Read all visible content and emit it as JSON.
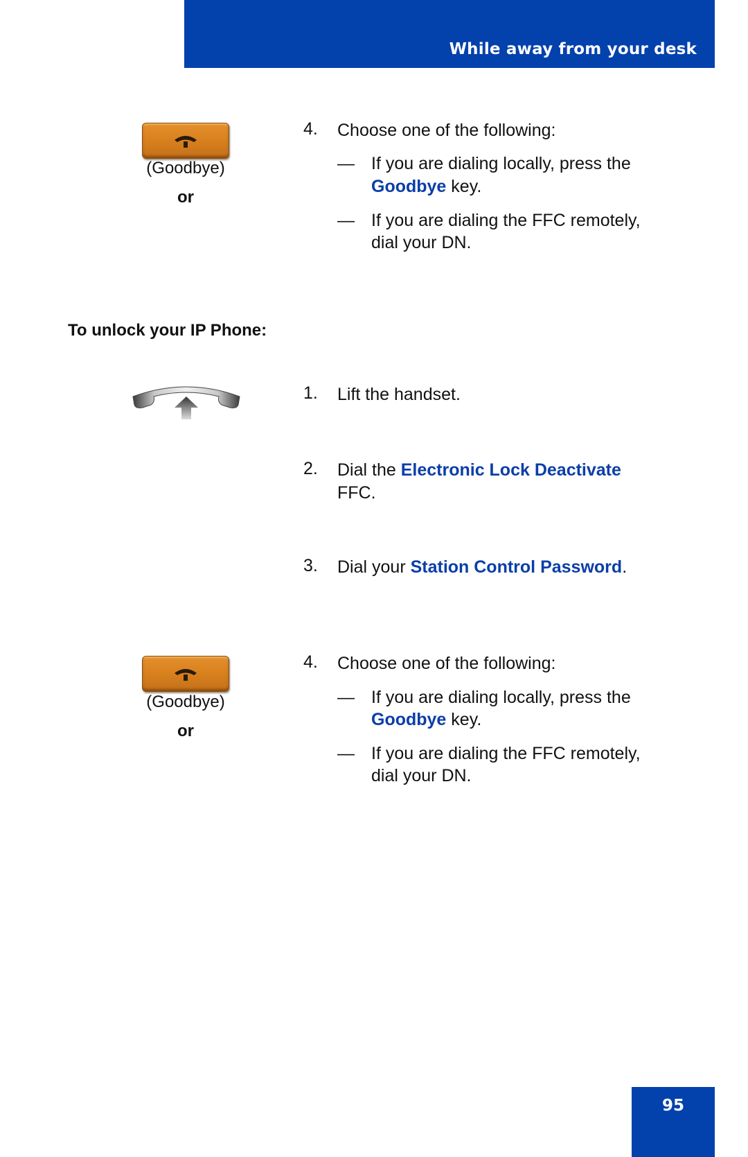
{
  "header": {
    "title": "While away from your desk",
    "color": "#0341ad"
  },
  "section_top": {
    "key_label": "(Goodbye)",
    "or_label": "or",
    "step": {
      "number": "4.",
      "text": "Choose one of the following:",
      "options": [
        {
          "line1": "If you are dialing locally, press the",
          "highlight": "Goodbye",
          "line2_rest": " key."
        },
        {
          "line1": "If you are dialing the FFC remotely,",
          "line2": "dial your DN."
        }
      ]
    }
  },
  "section_unlock": {
    "heading": "To unlock your IP Phone:",
    "steps": [
      {
        "number": "1.",
        "text": "Lift the handset."
      },
      {
        "number": "2.",
        "prefix": "Dial the ",
        "highlight": "Electronic Lock Deactivate",
        "line2": "FFC."
      },
      {
        "number": "3.",
        "prefix": "Dial your ",
        "highlight": "Station Control Password",
        "suffix": "."
      }
    ],
    "key_label": "(Goodbye)",
    "or_label": "or",
    "step4": {
      "number": "4.",
      "text": "Choose one of the following:",
      "options": [
        {
          "line1": "If you are dialing locally, press the",
          "highlight": "Goodbye",
          "line2_rest": " key."
        },
        {
          "line1": "If you are dialing the FFC remotely,",
          "line2": "dial your DN."
        }
      ]
    }
  },
  "dash": "—",
  "page_number": "95",
  "colors": {
    "highlight": "#0a3ea8",
    "key_orange": "#d9821e"
  }
}
